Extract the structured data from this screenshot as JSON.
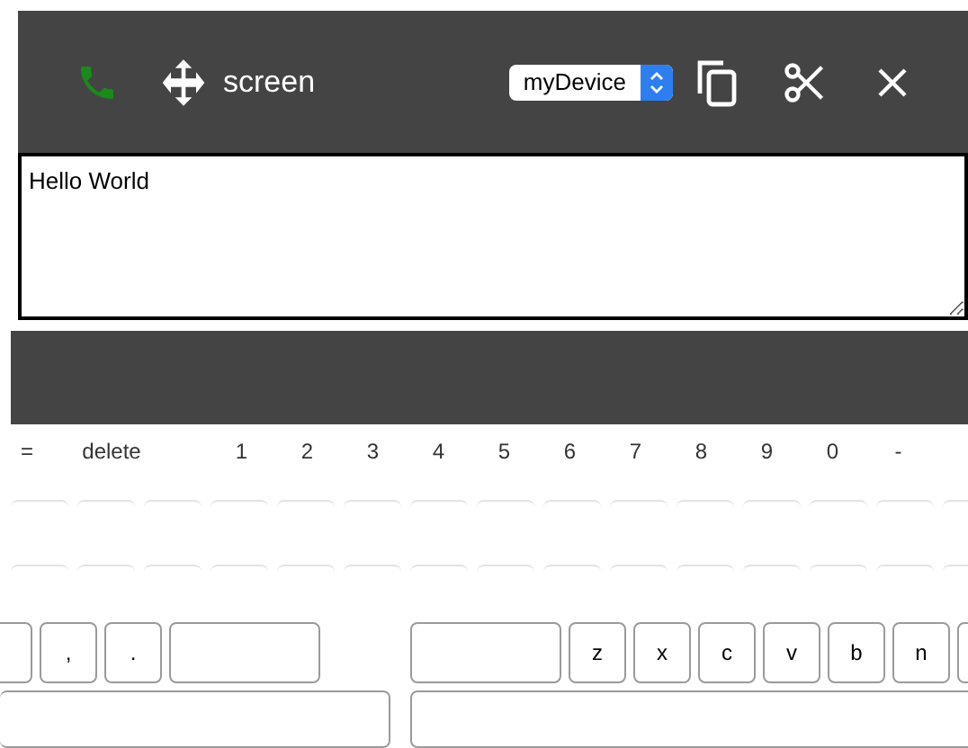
{
  "toolbar": {
    "title": "screen",
    "device_select": {
      "value": "myDevice"
    }
  },
  "text_area": {
    "value": "Hello World"
  },
  "keyboard": {
    "number_row": [
      {
        "kind": "char",
        "label": "="
      },
      {
        "kind": "char",
        "label": "delete"
      },
      {
        "kind": "char",
        "label": "1"
      },
      {
        "kind": "char",
        "label": "2"
      },
      {
        "kind": "char",
        "label": "3"
      },
      {
        "kind": "char",
        "label": "4"
      },
      {
        "kind": "char",
        "label": "5"
      },
      {
        "kind": "char",
        "label": "6"
      },
      {
        "kind": "char",
        "label": "7"
      },
      {
        "kind": "char",
        "label": "8"
      },
      {
        "kind": "char",
        "label": "9"
      },
      {
        "kind": "char",
        "label": "0"
      },
      {
        "kind": "char",
        "label": "-"
      }
    ],
    "left_row": [
      {
        "kind": "blank"
      },
      {
        "kind": "char",
        "label": ","
      },
      {
        "kind": "char",
        "label": "."
      },
      {
        "kind": "wide"
      }
    ],
    "right_row": [
      {
        "kind": "wide"
      },
      {
        "kind": "char",
        "label": "z"
      },
      {
        "kind": "char",
        "label": "x"
      },
      {
        "kind": "char",
        "label": "c"
      },
      {
        "kind": "char",
        "label": "v"
      },
      {
        "kind": "char",
        "label": "b"
      },
      {
        "kind": "char",
        "label": "n"
      },
      {
        "kind": "blank"
      }
    ]
  }
}
